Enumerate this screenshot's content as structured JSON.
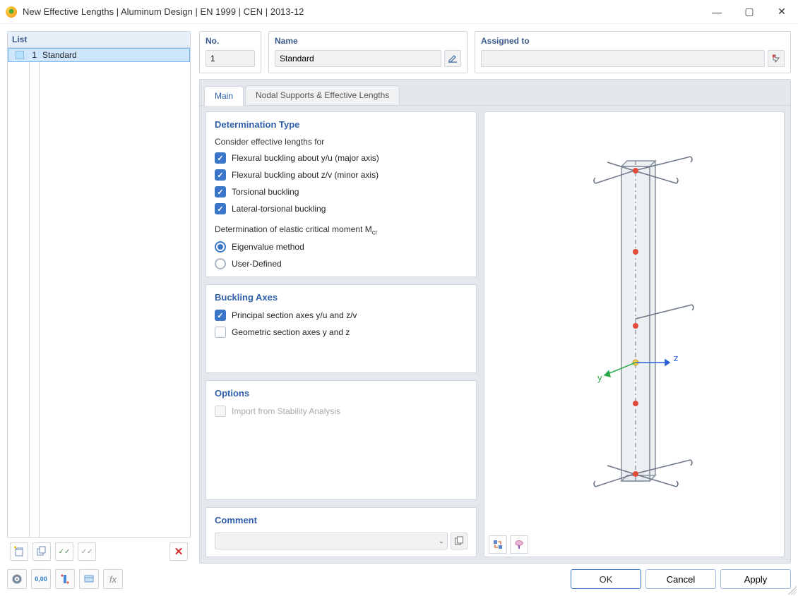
{
  "window": {
    "title": "New Effective Lengths | Aluminum Design | EN 1999 | CEN | 2013-12"
  },
  "sidebar": {
    "header": "List",
    "rows": [
      {
        "index": "1",
        "name": "Standard"
      }
    ]
  },
  "fields": {
    "no": {
      "label": "No.",
      "value": "1"
    },
    "name": {
      "label": "Name",
      "value": "Standard"
    },
    "assigned": {
      "label": "Assigned to",
      "value": ""
    }
  },
  "tabs": {
    "main": "Main",
    "nodal": "Nodal Supports & Effective Lengths"
  },
  "sections": {
    "determination": {
      "title": "Determination Type",
      "consider_label": "Consider effective lengths for",
      "checks": {
        "flex_y": "Flexural buckling about y/u (major axis)",
        "flex_z": "Flexural buckling about z/v (minor axis)",
        "torsional": "Torsional buckling",
        "lateral": "Lateral-torsional buckling"
      },
      "mcr_label": "Determination of elastic critical moment M",
      "mcr_sub": "cr",
      "radios": {
        "eigen": "Eigenvalue method",
        "user": "User-Defined"
      }
    },
    "axes": {
      "title": "Buckling Axes",
      "principal": "Principal section axes y/u and z/v",
      "geometric": "Geometric section axes y and z"
    },
    "options": {
      "title": "Options",
      "import": "Import from Stability Analysis"
    },
    "comment": {
      "title": "Comment",
      "value": ""
    }
  },
  "preview": {
    "y_label": "y",
    "z_label": "z"
  },
  "footer": {
    "ok": "OK",
    "cancel": "Cancel",
    "apply": "Apply"
  }
}
